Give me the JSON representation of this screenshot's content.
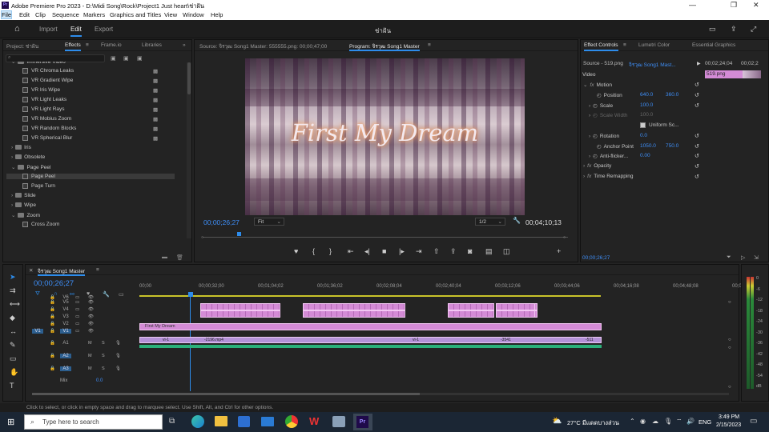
{
  "window": {
    "title": "Adobe Premiere Pro 2023 - D:\\Midi Song\\Rock\\Project1 Just heart\\ช่าฝัน",
    "app_icon": "Pr"
  },
  "menu": [
    "File",
    "Edit",
    "Clip",
    "Sequence",
    "Markers",
    "Graphics and Titles",
    "View",
    "Window",
    "Help"
  ],
  "workspace": {
    "tabs": [
      "Import",
      "Edit",
      "Export"
    ],
    "selected": "Edit",
    "project_name": "ช่าฝัน"
  },
  "project_panel": {
    "tabs": [
      "Project: ช่าฝัน",
      "Effects",
      "Frame.io",
      "Libraries"
    ],
    "selected_tab": "Effects",
    "effects": [
      {
        "label": "Immersive Video",
        "type": "folder-open",
        "indent": 1
      },
      {
        "label": "VR Chroma Leaks",
        "type": "effect",
        "indent": 2
      },
      {
        "label": "VR Gradient Wipe",
        "type": "effect",
        "indent": 2
      },
      {
        "label": "VR Iris Wipe",
        "type": "effect",
        "indent": 2
      },
      {
        "label": "VR Light Leaks",
        "type": "effect",
        "indent": 2
      },
      {
        "label": "VR Light Rays",
        "type": "effect",
        "indent": 2
      },
      {
        "label": "VR Mobius Zoom",
        "type": "effect",
        "indent": 2
      },
      {
        "label": "VR Random Blocks",
        "type": "effect",
        "indent": 2
      },
      {
        "label": "VR Spherical Blur",
        "type": "effect",
        "indent": 2
      },
      {
        "label": "Iris",
        "type": "folder",
        "indent": 1
      },
      {
        "label": "Obsolete",
        "type": "folder",
        "indent": 1
      },
      {
        "label": "Page Peel",
        "type": "folder-open",
        "indent": 1
      },
      {
        "label": "Page Peel",
        "type": "effect",
        "indent": 2,
        "selected": true
      },
      {
        "label": "Page Turn",
        "type": "effect",
        "indent": 2
      },
      {
        "label": "Slide",
        "type": "folder",
        "indent": 1
      },
      {
        "label": "Wipe",
        "type": "folder",
        "indent": 1
      },
      {
        "label": "Zoom",
        "type": "folder-open",
        "indent": 1
      },
      {
        "label": "Cross Zoom",
        "type": "effect",
        "indent": 2
      }
    ]
  },
  "source_monitor": {
    "label": "Source: จิรวุฒ Song1 Master: 555555.png: 00;00;47;00"
  },
  "program_monitor": {
    "label": "Program: จิรวุฒ Song1 Master",
    "preview_text": "First My Dream",
    "timecode": "00;00;26;27",
    "fit": "Fit",
    "resolution": "1/2",
    "duration": "00;04;10;13"
  },
  "effect_controls": {
    "tabs": [
      "Effect Controls",
      "Lumetri Color",
      "Essential Graphics"
    ],
    "source": "Source - 519.png",
    "sequence": "จิรวุฒ Song1 Mast...",
    "ruler_time": "00;02;24;04",
    "ruler_time2": "00;02;2",
    "clip_name": "519.png",
    "section": "Video",
    "motion": "Motion",
    "position_label": "Position",
    "position_x": "640.0",
    "position_y": "360.0",
    "scale_label": "Scale",
    "scale_value": "100.0",
    "scale_width_label": "Scale Width",
    "scale_width_value": "100.0",
    "uniform_label": "Uniform Sc...",
    "rotation_label": "Rotation",
    "rotation_value": "0.0",
    "anchor_label": "Anchor Point",
    "anchor_x": "1050.0",
    "anchor_y": "750.0",
    "antiflicker_label": "Anti-flicker...",
    "antiflicker_value": "0.00",
    "opacity_label": "Opacity",
    "time_remap_label": "Time Remapping",
    "timecode": "00;00;26;27"
  },
  "timeline": {
    "sequence_tab": "จิรวุฒ Song1 Master",
    "timecode": "00;00;26;27",
    "ruler": [
      "00;00",
      "00;00;32;00",
      "00;01;04;02",
      "00;01;36;02",
      "00;02;08;04",
      "00;02;40;04",
      "00;03;12;06",
      "00;03;44;06",
      "00;04;16;08",
      "00;04;48;08",
      "00;0"
    ],
    "video_tracks": [
      "V6",
      "V5",
      "V4",
      "V3",
      "V2",
      "V1"
    ],
    "audio_tracks": [
      "A1",
      "A2",
      "A3"
    ],
    "mix_label": "Mix",
    "mix_value": "0.0",
    "title_clip": "First My Dream",
    "v1_clip_labels": [
      "vi-1",
      "-2196.mp4",
      "vi-1",
      "-3541",
      "-511"
    ]
  },
  "meter": {
    "labels": [
      "0",
      "-6",
      "-12",
      "-18",
      "-24",
      "-30",
      "-36",
      "-42",
      "-48",
      "-54",
      "dB"
    ]
  },
  "status": {
    "text": "Click to select, or click in empty space and drag to marquee select. Use Shift, Alt, and Ctrl for other options."
  },
  "taskbar": {
    "search_placeholder": "Type here to search",
    "weather": "27°C มีแดดบางส่วน",
    "lang": "ENG",
    "time": "3:49 PM",
    "date": "2/15/2023"
  },
  "colors": {
    "accent": "#2d8ceb",
    "clip_pink": "#d48bd6",
    "audio_green": "#2bb07a",
    "timecode_blue": "#3e8ef7"
  }
}
